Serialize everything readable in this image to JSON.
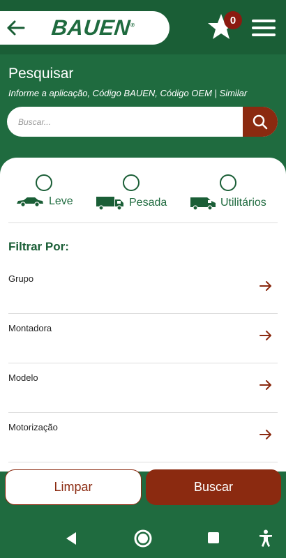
{
  "header": {
    "logo_text": "BAUEN",
    "logo_reg": "®",
    "favorites_count": "0"
  },
  "search": {
    "title": "Pesquisar",
    "subtitle": "Informe a aplicação, Código BAUEN, Código OEM | Similar",
    "placeholder": "Buscar..."
  },
  "vehicle_types": [
    {
      "label": "Leve"
    },
    {
      "label": "Pesada"
    },
    {
      "label": "Utilitários"
    }
  ],
  "filters": {
    "title": "Filtrar Por:",
    "items": [
      {
        "label": "Grupo"
      },
      {
        "label": "Montadora"
      },
      {
        "label": "Modelo"
      },
      {
        "label": "Motorização"
      }
    ]
  },
  "actions": {
    "clear_label": "Limpar",
    "search_label": "Buscar"
  },
  "colors": {
    "brand_green": "#1f6b3f",
    "accent_red": "#8b2a10"
  }
}
